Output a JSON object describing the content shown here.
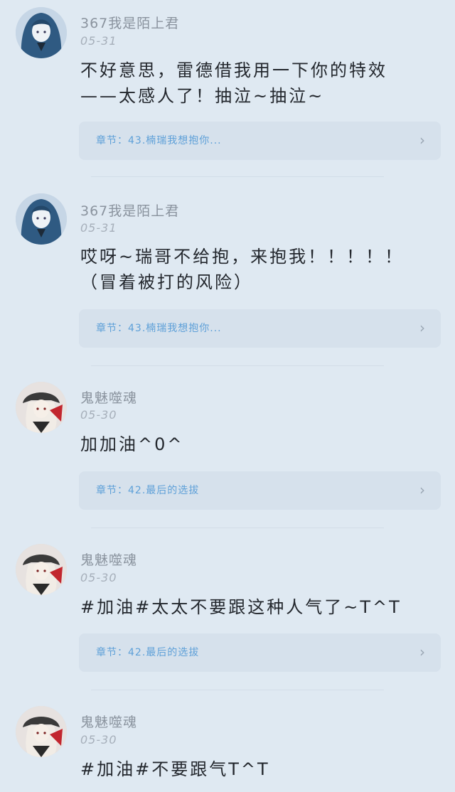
{
  "colors": {
    "background": "#dfe9f2",
    "chapter_bg": "#d6e1ec",
    "chapter_text": "#5ea0d8",
    "username": "#8a939e",
    "content": "#23272d"
  },
  "comments": [
    {
      "avatar": "blue-haired-girl-avatar",
      "username": "367我是陌上君",
      "date": "05-31",
      "content_line1": "不好意思，雷德借我用一下你的特效",
      "content_line2": "——太感人了！抽泣~抽泣~",
      "chapter": "章节：43.楠瑞我想抱你...",
      "chevron": "›"
    },
    {
      "avatar": "blue-haired-girl-avatar",
      "username": "367我是陌上君",
      "date": "05-31",
      "content_line1": "哎呀~瑞哥不给抱，来抱我！！！！！",
      "content_line2": "（冒着被打的风险）",
      "chapter": "章节：43.楠瑞我想抱你...",
      "chevron": "›"
    },
    {
      "avatar": "ghost-girl-avatar",
      "username": "鬼魅噬魂",
      "date": "05-30",
      "content_line1": "加加油^0^",
      "content_line2": "",
      "chapter": "章节：42.最后的选拔",
      "chevron": "›"
    },
    {
      "avatar": "ghost-girl-avatar",
      "username": "鬼魅噬魂",
      "date": "05-30",
      "content_line1": "#加油#太太不要跟这种人气了~T^T",
      "content_line2": "",
      "chapter": "章节：42.最后的选拔",
      "chevron": "›"
    },
    {
      "avatar": "ghost-girl-avatar",
      "username": "鬼魅噬魂",
      "date": "05-30",
      "content_line1": "#加油#不要跟气T^T",
      "content_line2": ""
    }
  ]
}
